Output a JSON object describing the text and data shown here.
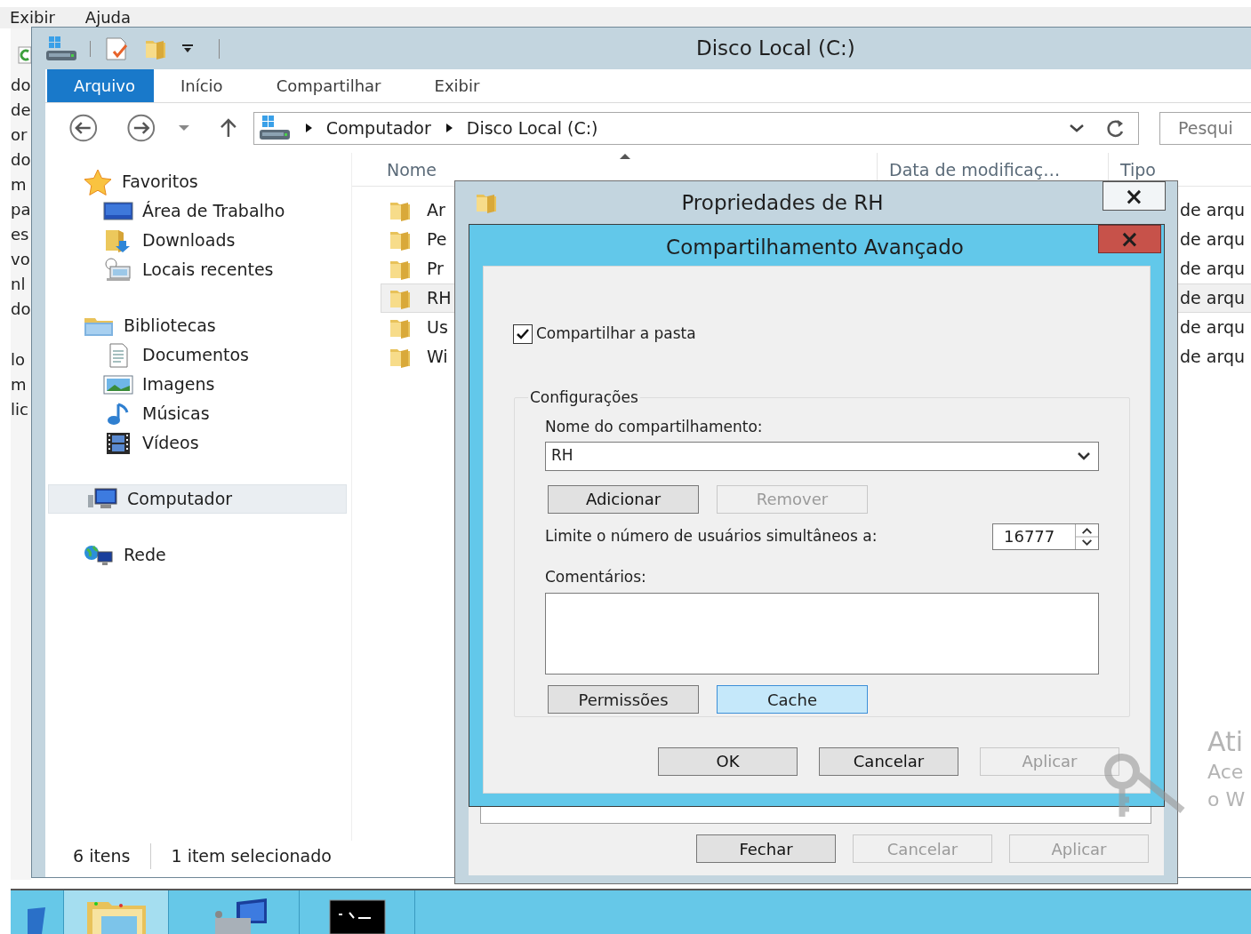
{
  "background_window": {
    "menu": [
      "Exibir",
      "Ajuda"
    ],
    "clipped_lines": [
      [
        "do",
        "de",
        "or",
        "do",
        "m",
        "pa",
        "es",
        "vo",
        "nl",
        "do"
      ],
      [
        "lo",
        "m",
        "lic"
      ]
    ]
  },
  "explorer": {
    "title": "Disco Local (C:)",
    "ribbon_tabs": [
      {
        "label": "Arquivo",
        "selected": true
      },
      {
        "label": "Início",
        "selected": false
      },
      {
        "label": "Compartilhar",
        "selected": false
      },
      {
        "label": "Exibir",
        "selected": false
      }
    ],
    "address": {
      "segments": [
        "Computador",
        "Disco Local (C:)"
      ]
    },
    "search": {
      "placeholder": "Pesqui"
    },
    "nav": [
      {
        "label": "Favoritos",
        "selected": false,
        "children": [
          {
            "label": "Área de Trabalho",
            "selected": false
          },
          {
            "label": "Downloads",
            "selected": false
          },
          {
            "label": "Locais recentes",
            "selected": false
          }
        ]
      },
      {
        "label": "Bibliotecas",
        "selected": false,
        "children": [
          {
            "label": "Documentos",
            "selected": false
          },
          {
            "label": "Imagens",
            "selected": false
          },
          {
            "label": "Músicas",
            "selected": false
          },
          {
            "label": "Vídeos",
            "selected": false
          }
        ]
      },
      {
        "label": "Computador",
        "selected": true
      },
      {
        "label": "Rede",
        "selected": false
      }
    ],
    "columns": [
      "Nome",
      "Data de modificaç…",
      "Tipo"
    ],
    "files": [
      {
        "name": "Ar",
        "type": "de arqu",
        "selected": false
      },
      {
        "name": "Pe",
        "type": "de arqu",
        "selected": false
      },
      {
        "name": "Pr",
        "type": "de arqu",
        "selected": false
      },
      {
        "name": "RH",
        "type": "de arqu",
        "selected": true
      },
      {
        "name": "Us",
        "type": "de arqu",
        "selected": false
      },
      {
        "name": "Wi",
        "type": "de arqu",
        "selected": false
      }
    ],
    "status": {
      "count": "6 itens",
      "selection": "1 item selecionado"
    }
  },
  "properties_dialog": {
    "title": "Propriedades de RH",
    "close": "×",
    "buttons": [
      {
        "label": "Fechar",
        "disabled": false
      },
      {
        "label": "Cancelar",
        "disabled": true
      },
      {
        "label": "Aplicar",
        "disabled": true
      }
    ]
  },
  "advanced_sharing_dialog": {
    "title": "Compartilhamento Avançado",
    "close": "×",
    "share_checkbox": {
      "label": "Compartilhar a pasta",
      "checked": true
    },
    "group": "Configurações",
    "share_name_label": "Nome do compartilhamento:",
    "share_name": "RH",
    "name_buttons": [
      {
        "label": "Adicionar",
        "disabled": false
      },
      {
        "label": "Remover",
        "disabled": true
      }
    ],
    "limit_label": "Limite o número de usuários simultâneos a:",
    "limit_value": "16777",
    "comments_label": "Comentários:",
    "extra_buttons": [
      {
        "label": "Permissões",
        "hovered": false
      },
      {
        "label": "Cache",
        "hovered": true
      }
    ],
    "buttons": [
      {
        "label": "OK",
        "disabled": false
      },
      {
        "label": "Cancelar",
        "disabled": false
      },
      {
        "label": "Aplicar",
        "disabled": true
      }
    ]
  },
  "activation_notice": [
    "Ati",
    "Ace",
    "o W"
  ],
  "taskbar": {
    "items": [
      {
        "kind": "start",
        "active": false
      },
      {
        "kind": "explorer",
        "active": true
      },
      {
        "kind": "server-manager",
        "active": false
      },
      {
        "kind": "console",
        "active": false
      }
    ]
  }
}
